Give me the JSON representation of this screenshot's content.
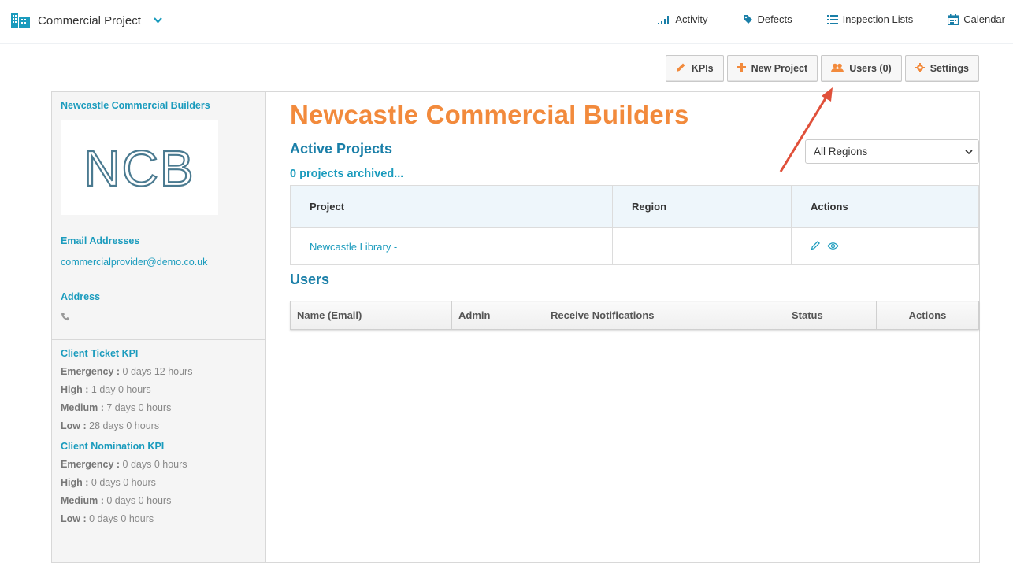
{
  "header": {
    "project_name": "Commercial Project",
    "nav": [
      {
        "label": "Activity",
        "icon": "signal-bars-icon"
      },
      {
        "label": "Defects",
        "icon": "tag-icon"
      },
      {
        "label": "Inspection Lists",
        "icon": "list-icon"
      },
      {
        "label": "Calendar",
        "icon": "calendar-icon"
      }
    ]
  },
  "toolbar": {
    "kpis": "KPIs",
    "new_project": "New Project",
    "users": "Users (0)",
    "settings": "Settings"
  },
  "sidebar": {
    "company_name": "Newcastle Commercial Builders",
    "logo_text": "NCB",
    "email_heading": "Email Addresses",
    "email": "commercialprovider@demo.co.uk",
    "address_heading": "Address",
    "client_ticket_heading": "Client Ticket KPI",
    "client_ticket": [
      {
        "label": "Emergency :",
        "value": "0 days 12 hours"
      },
      {
        "label": "High :",
        "value": "1 day 0 hours"
      },
      {
        "label": "Medium :",
        "value": "7 days 0 hours"
      },
      {
        "label": "Low :",
        "value": "28 days 0 hours"
      }
    ],
    "client_nomination_heading": "Client Nomination KPI",
    "client_nomination": [
      {
        "label": "Emergency :",
        "value": "0 days 0 hours"
      },
      {
        "label": "High :",
        "value": "0 days 0 hours"
      },
      {
        "label": "Medium :",
        "value": "0 days 0 hours"
      },
      {
        "label": "Low :",
        "value": "0 days 0 hours"
      }
    ]
  },
  "main": {
    "title": "Newcastle Commercial Builders",
    "active_projects": "Active Projects",
    "archived": "0 projects archived...",
    "region_select": "All Regions",
    "projects_table": {
      "headers": [
        "Project",
        "Region",
        "Actions"
      ],
      "rows": [
        {
          "project": "Newcastle Library -",
          "region": ""
        }
      ]
    },
    "users_heading": "Users",
    "users_table": {
      "headers": [
        "Name (Email)",
        "Admin",
        "Receive Notifications",
        "Status",
        "Actions"
      ]
    }
  },
  "colors": {
    "accent_orange": "#f28a3c",
    "accent_teal": "#1a9bbd",
    "annotation_red": "#e0503a"
  }
}
